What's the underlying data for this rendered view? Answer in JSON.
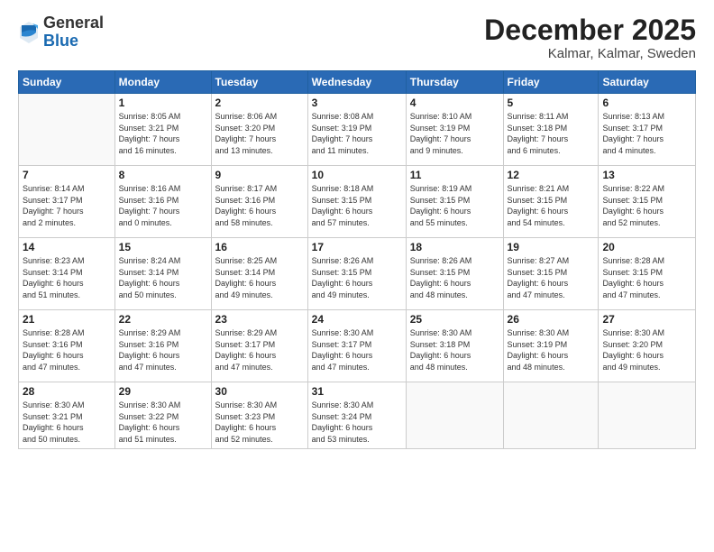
{
  "logo": {
    "general": "General",
    "blue": "Blue"
  },
  "title": "December 2025",
  "subtitle": "Kalmar, Kalmar, Sweden",
  "headers": [
    "Sunday",
    "Monday",
    "Tuesday",
    "Wednesday",
    "Thursday",
    "Friday",
    "Saturday"
  ],
  "weeks": [
    [
      {
        "day": "",
        "info": ""
      },
      {
        "day": "1",
        "info": "Sunrise: 8:05 AM\nSunset: 3:21 PM\nDaylight: 7 hours\nand 16 minutes."
      },
      {
        "day": "2",
        "info": "Sunrise: 8:06 AM\nSunset: 3:20 PM\nDaylight: 7 hours\nand 13 minutes."
      },
      {
        "day": "3",
        "info": "Sunrise: 8:08 AM\nSunset: 3:19 PM\nDaylight: 7 hours\nand 11 minutes."
      },
      {
        "day": "4",
        "info": "Sunrise: 8:10 AM\nSunset: 3:19 PM\nDaylight: 7 hours\nand 9 minutes."
      },
      {
        "day": "5",
        "info": "Sunrise: 8:11 AM\nSunset: 3:18 PM\nDaylight: 7 hours\nand 6 minutes."
      },
      {
        "day": "6",
        "info": "Sunrise: 8:13 AM\nSunset: 3:17 PM\nDaylight: 7 hours\nand 4 minutes."
      }
    ],
    [
      {
        "day": "7",
        "info": "Sunrise: 8:14 AM\nSunset: 3:17 PM\nDaylight: 7 hours\nand 2 minutes."
      },
      {
        "day": "8",
        "info": "Sunrise: 8:16 AM\nSunset: 3:16 PM\nDaylight: 7 hours\nand 0 minutes."
      },
      {
        "day": "9",
        "info": "Sunrise: 8:17 AM\nSunset: 3:16 PM\nDaylight: 6 hours\nand 58 minutes."
      },
      {
        "day": "10",
        "info": "Sunrise: 8:18 AM\nSunset: 3:15 PM\nDaylight: 6 hours\nand 57 minutes."
      },
      {
        "day": "11",
        "info": "Sunrise: 8:19 AM\nSunset: 3:15 PM\nDaylight: 6 hours\nand 55 minutes."
      },
      {
        "day": "12",
        "info": "Sunrise: 8:21 AM\nSunset: 3:15 PM\nDaylight: 6 hours\nand 54 minutes."
      },
      {
        "day": "13",
        "info": "Sunrise: 8:22 AM\nSunset: 3:15 PM\nDaylight: 6 hours\nand 52 minutes."
      }
    ],
    [
      {
        "day": "14",
        "info": "Sunrise: 8:23 AM\nSunset: 3:14 PM\nDaylight: 6 hours\nand 51 minutes."
      },
      {
        "day": "15",
        "info": "Sunrise: 8:24 AM\nSunset: 3:14 PM\nDaylight: 6 hours\nand 50 minutes."
      },
      {
        "day": "16",
        "info": "Sunrise: 8:25 AM\nSunset: 3:14 PM\nDaylight: 6 hours\nand 49 minutes."
      },
      {
        "day": "17",
        "info": "Sunrise: 8:26 AM\nSunset: 3:15 PM\nDaylight: 6 hours\nand 49 minutes."
      },
      {
        "day": "18",
        "info": "Sunrise: 8:26 AM\nSunset: 3:15 PM\nDaylight: 6 hours\nand 48 minutes."
      },
      {
        "day": "19",
        "info": "Sunrise: 8:27 AM\nSunset: 3:15 PM\nDaylight: 6 hours\nand 47 minutes."
      },
      {
        "day": "20",
        "info": "Sunrise: 8:28 AM\nSunset: 3:15 PM\nDaylight: 6 hours\nand 47 minutes."
      }
    ],
    [
      {
        "day": "21",
        "info": "Sunrise: 8:28 AM\nSunset: 3:16 PM\nDaylight: 6 hours\nand 47 minutes."
      },
      {
        "day": "22",
        "info": "Sunrise: 8:29 AM\nSunset: 3:16 PM\nDaylight: 6 hours\nand 47 minutes."
      },
      {
        "day": "23",
        "info": "Sunrise: 8:29 AM\nSunset: 3:17 PM\nDaylight: 6 hours\nand 47 minutes."
      },
      {
        "day": "24",
        "info": "Sunrise: 8:30 AM\nSunset: 3:17 PM\nDaylight: 6 hours\nand 47 minutes."
      },
      {
        "day": "25",
        "info": "Sunrise: 8:30 AM\nSunset: 3:18 PM\nDaylight: 6 hours\nand 48 minutes."
      },
      {
        "day": "26",
        "info": "Sunrise: 8:30 AM\nSunset: 3:19 PM\nDaylight: 6 hours\nand 48 minutes."
      },
      {
        "day": "27",
        "info": "Sunrise: 8:30 AM\nSunset: 3:20 PM\nDaylight: 6 hours\nand 49 minutes."
      }
    ],
    [
      {
        "day": "28",
        "info": "Sunrise: 8:30 AM\nSunset: 3:21 PM\nDaylight: 6 hours\nand 50 minutes."
      },
      {
        "day": "29",
        "info": "Sunrise: 8:30 AM\nSunset: 3:22 PM\nDaylight: 6 hours\nand 51 minutes."
      },
      {
        "day": "30",
        "info": "Sunrise: 8:30 AM\nSunset: 3:23 PM\nDaylight: 6 hours\nand 52 minutes."
      },
      {
        "day": "31",
        "info": "Sunrise: 8:30 AM\nSunset: 3:24 PM\nDaylight: 6 hours\nand 53 minutes."
      },
      {
        "day": "",
        "info": ""
      },
      {
        "day": "",
        "info": ""
      },
      {
        "day": "",
        "info": ""
      }
    ]
  ]
}
